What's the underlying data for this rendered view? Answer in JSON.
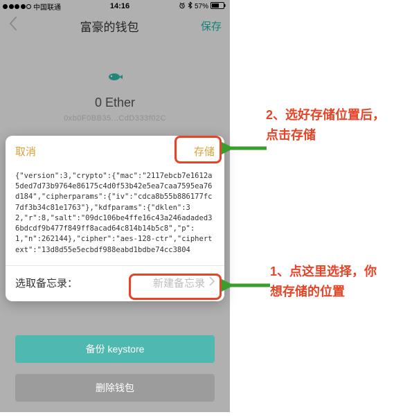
{
  "status": {
    "carrier": "中国联通",
    "time": "14:16",
    "alarm_icon": "alarm-icon",
    "bt_icon": "bluetooth-icon",
    "battery_pct": "57%"
  },
  "nav": {
    "title": "富豪的钱包",
    "save": "保存"
  },
  "wallet": {
    "balance": "0 Ether",
    "address": "0xb0F0BB35...CdD333f02C"
  },
  "modal": {
    "cancel": "取消",
    "store": "存储",
    "json_text": "{\"version\":3,\"crypto\":{\"mac\":\"2117ebcb7e1612a5ded7d73b9764e86175c4d0f53b42e5ea7caa7595ea76d184\",\"cipherparams\":{\"iv\":\"cdca8b55b886177fc7df3b34c81e1763\"},\"kdfparams\":{\"dklen\":32,\"r\":8,\"salt\":\"09dc106be4ffe16c43a246adaded36bdcdf9b477f849ff8acad64c814b14b5c8\",\"p\":1,\"n\":262144},\"cipher\":\"aes-128-ctr\",\"ciphertext\":\"13d8d55e5ecbdf988eabd1bdbe74cc3804",
    "memo_label": "选取备忘录：",
    "memo_action": "新建备忘录"
  },
  "buttons": {
    "backup": "备份 keystore",
    "delete": "删除钱包"
  },
  "annotations": {
    "step1": "1、点这里选择，你想存储的位置",
    "step2": "2、选好存储位置后，点击存储"
  }
}
